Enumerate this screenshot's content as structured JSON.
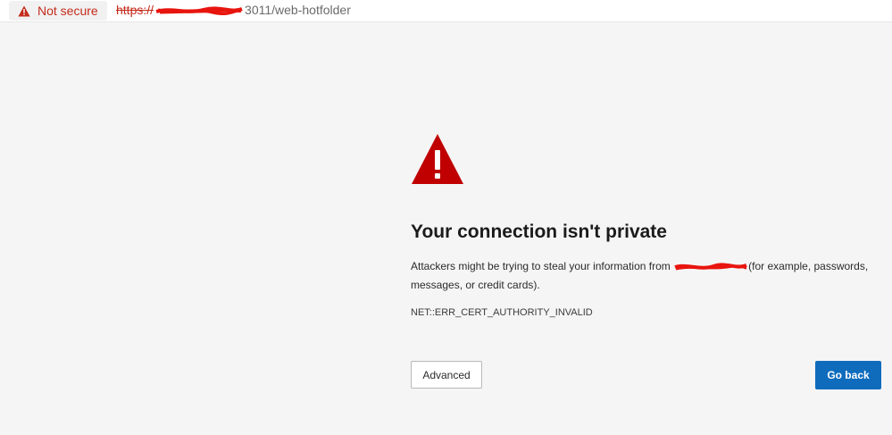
{
  "addressbar": {
    "security_label": "Not secure",
    "url_scheme": "https://",
    "url_suffix": "3011/web-hotfolder"
  },
  "icons": {
    "security": "warning-triangle-icon",
    "main": "warning-triangle-icon"
  },
  "error": {
    "title": "Your connection isn't private",
    "description_before": "Attackers might be trying to steal your information from ",
    "description_after": "(for example, passwords, messages, or credit cards).",
    "code": "NET::ERR_CERT_AUTHORITY_INVALID"
  },
  "buttons": {
    "advanced": "Advanced",
    "go_back": "Go back"
  },
  "colors": {
    "warning_red": "#c00000",
    "redaction_red": "#e8150e",
    "primary_blue": "#0f6cbd",
    "background": "#f5f5f5"
  }
}
